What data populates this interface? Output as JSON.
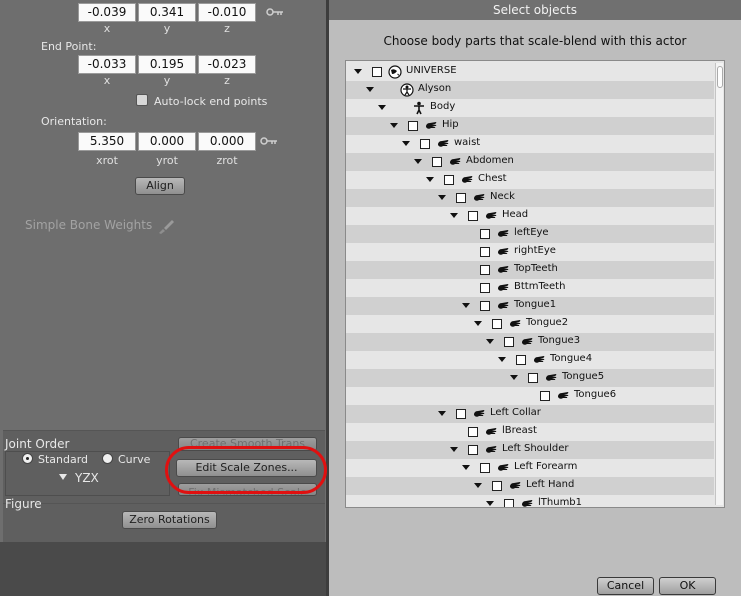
{
  "left": {
    "top_values": {
      "x": "-0.039",
      "y": "0.341",
      "z": "-0.010"
    },
    "axis_labels": {
      "x": "x",
      "y": "y",
      "z": "z",
      "xrot": "xrot",
      "yrot": "yrot",
      "zrot": "zrot"
    },
    "end_point_label": "End Point:",
    "end_point": {
      "x": "-0.033",
      "y": "0.195",
      "z": "-0.023"
    },
    "auto_lock_label": "Auto-lock end points",
    "orientation_label": "Orientation:",
    "orientation": {
      "xrot": "5.350",
      "yrot": "0.000",
      "zrot": "0.000"
    },
    "align_label": "Align",
    "simple_bone_weights_label": "Simple Bone Weights",
    "joint_order_label": "Joint Order",
    "standard_label": "Standard",
    "curve_label": "Curve",
    "order_value": "YZX",
    "create_smooth_label": "Create Smooth Trans",
    "edit_scale_zones_label": "Edit Scale Zones...",
    "fix_mismatched_label": "Fix Mismatched Scale",
    "figure_label": "Figure",
    "zero_rotations_label": "Zero Rotations"
  },
  "dialog": {
    "title": "Select objects",
    "subtitle": "Choose body parts that scale-blend with this actor",
    "cancel_label": "Cancel",
    "ok_label": "OK",
    "tree": [
      {
        "label": "UNIVERSE",
        "icon": "globe-icon",
        "depth": 0,
        "expand": true,
        "checkbox": true
      },
      {
        "label": "Alyson",
        "icon": "figure-icon",
        "depth": 1,
        "expand": true,
        "checkbox": false
      },
      {
        "label": "Body",
        "icon": "body-icon",
        "depth": 2,
        "expand": true,
        "checkbox": false
      },
      {
        "label": "Hip",
        "icon": "hand-icon",
        "depth": 3,
        "expand": true,
        "checkbox": true
      },
      {
        "label": "waist",
        "icon": "hand-icon",
        "depth": 4,
        "expand": true,
        "checkbox": true
      },
      {
        "label": "Abdomen",
        "icon": "hand-icon",
        "depth": 5,
        "expand": true,
        "checkbox": true
      },
      {
        "label": "Chest",
        "icon": "hand-icon",
        "depth": 6,
        "expand": true,
        "checkbox": true
      },
      {
        "label": "Neck",
        "icon": "hand-icon",
        "depth": 7,
        "expand": true,
        "checkbox": true
      },
      {
        "label": "Head",
        "icon": "hand-icon",
        "depth": 8,
        "expand": true,
        "checkbox": true
      },
      {
        "label": "leftEye",
        "icon": "hand-icon",
        "depth": 9,
        "expand": false,
        "checkbox": true
      },
      {
        "label": "rightEye",
        "icon": "hand-icon",
        "depth": 9,
        "expand": false,
        "checkbox": true
      },
      {
        "label": "TopTeeth",
        "icon": "hand-icon",
        "depth": 9,
        "expand": false,
        "checkbox": true
      },
      {
        "label": "BttmTeeth",
        "icon": "hand-icon",
        "depth": 9,
        "expand": false,
        "checkbox": true
      },
      {
        "label": "Tongue1",
        "icon": "hand-icon",
        "depth": 9,
        "expand": true,
        "checkbox": true
      },
      {
        "label": "Tongue2",
        "icon": "hand-icon",
        "depth": 10,
        "expand": true,
        "checkbox": true
      },
      {
        "label": "Tongue3",
        "icon": "hand-icon",
        "depth": 11,
        "expand": true,
        "checkbox": true
      },
      {
        "label": "Tongue4",
        "icon": "hand-icon",
        "depth": 12,
        "expand": true,
        "checkbox": true
      },
      {
        "label": "Tongue5",
        "icon": "hand-icon",
        "depth": 13,
        "expand": true,
        "checkbox": true
      },
      {
        "label": "Tongue6",
        "icon": "hand-icon",
        "depth": 14,
        "expand": false,
        "checkbox": true
      },
      {
        "label": "Left Collar",
        "icon": "hand-icon",
        "depth": 7,
        "expand": true,
        "checkbox": true
      },
      {
        "label": "lBreast",
        "icon": "hand-icon",
        "depth": 8,
        "expand": false,
        "checkbox": true
      },
      {
        "label": "Left Shoulder",
        "icon": "hand-icon",
        "depth": 8,
        "expand": true,
        "checkbox": true
      },
      {
        "label": "Left Forearm",
        "icon": "hand-icon",
        "depth": 9,
        "expand": true,
        "checkbox": true
      },
      {
        "label": "Left Hand",
        "icon": "hand-icon",
        "depth": 10,
        "expand": true,
        "checkbox": true
      },
      {
        "label": "lThumb1",
        "icon": "hand-icon",
        "depth": 11,
        "expand": true,
        "checkbox": true
      }
    ]
  }
}
